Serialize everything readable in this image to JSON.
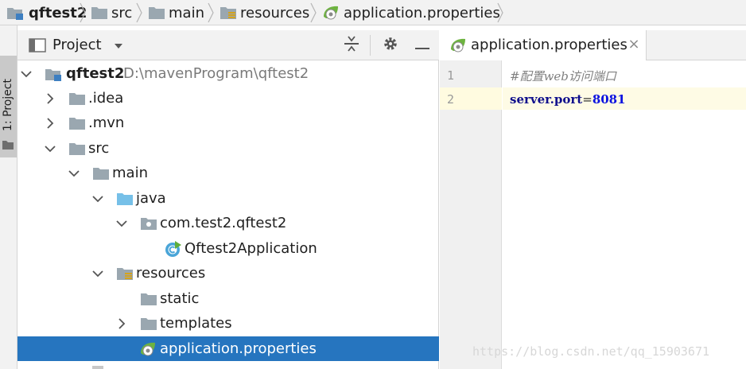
{
  "breadcrumb": [
    {
      "label": "qftest2",
      "icon": "module-folder-icon"
    },
    {
      "label": "src",
      "icon": "folder-icon"
    },
    {
      "label": "main",
      "icon": "folder-icon"
    },
    {
      "label": "resources",
      "icon": "resources-folder-icon"
    },
    {
      "label": "application.properties",
      "icon": "spring-properties-icon"
    }
  ],
  "tool_stripe": {
    "label": "1: Project"
  },
  "project_panel": {
    "title": "Project",
    "tree": [
      {
        "label": "qftest2",
        "path": "D:\\mavenProgram\\qftest2",
        "icon": "module-folder-icon",
        "expanded": true
      },
      {
        "label": ".idea",
        "icon": "folder-icon",
        "expanded": false
      },
      {
        "label": ".mvn",
        "icon": "folder-icon",
        "expanded": false
      },
      {
        "label": "src",
        "icon": "folder-icon",
        "expanded": true
      },
      {
        "label": "main",
        "icon": "folder-icon",
        "expanded": true
      },
      {
        "label": "java",
        "icon": "source-folder-icon",
        "expanded": true
      },
      {
        "label": "com.test2.qftest2",
        "icon": "package-icon",
        "expanded": true
      },
      {
        "label": "Qftest2Application",
        "icon": "spring-boot-class-icon"
      },
      {
        "label": "resources",
        "icon": "resources-folder-icon",
        "expanded": true
      },
      {
        "label": "static",
        "icon": "folder-icon"
      },
      {
        "label": "templates",
        "icon": "folder-icon",
        "expanded": false
      },
      {
        "label": "application.properties",
        "icon": "spring-properties-icon",
        "selected": true
      }
    ]
  },
  "editor": {
    "tab": {
      "label": "application.properties",
      "close": "×"
    },
    "lines": [
      {
        "number": "1",
        "comment": "#配置web访问端口"
      },
      {
        "number": "2",
        "key": "server.port",
        "eq": "=",
        "value": "8081"
      }
    ]
  },
  "watermark": "https://blog.csdn.net/qq_15903671",
  "colors": {
    "selection": "#2675bf",
    "current_line": "#fefbe5",
    "key": "#0f0f8c",
    "value": "#0b12e0",
    "spring_green": "#6db33f"
  }
}
